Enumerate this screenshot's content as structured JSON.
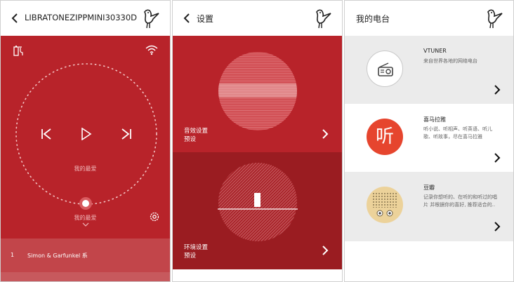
{
  "colors": {
    "red": "#b8232a",
    "red_dark": "#9a1c21",
    "red_row": "#c2454a",
    "grey_row": "#ebebeb",
    "white": "#ffffff"
  },
  "panel1": {
    "title": "LIBRATONEZIPPMINI30330D",
    "preset_label": "我的最爱",
    "favorite_label": "我的最爱",
    "track": {
      "number": "1",
      "name": "Simon & Garfunkel 系"
    }
  },
  "panel2": {
    "title": "设置",
    "sound": {
      "line1": "音效设置",
      "line2": "预设"
    },
    "env": {
      "line1": "环境设置",
      "line2": "预设"
    }
  },
  "panel3": {
    "title": "我的电台",
    "stations": [
      {
        "name": "VTUNER",
        "desc1": "来自世界各地的网络电台",
        "desc2": "",
        "icon": "radio-icon"
      },
      {
        "name": "喜马拉雅",
        "desc1": "听小说、听相声、听英语、听儿",
        "desc2": "歌、听故事，尽在喜马拉雅",
        "icon_text": "听"
      },
      {
        "name": "豆瓣",
        "desc1": "记录你想听的、在听的和听过的唱",
        "desc2": "片 并根据你的喜好, 推荐适合的..",
        "icon": "douban-icon"
      }
    ]
  }
}
